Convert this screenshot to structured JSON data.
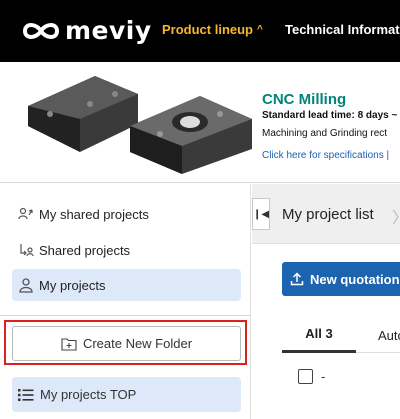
{
  "header": {
    "logo_text": "meviy",
    "nav": {
      "product_lineup": "Product lineup",
      "technical_information": "Technical Informat"
    }
  },
  "banner": {
    "title": "CNC Milling",
    "lead_time": "Standard lead time: 8 days ~",
    "description": "Machining and Grinding rect",
    "link": "Click here for specifications |"
  },
  "sidebar": {
    "items": [
      {
        "label": "My shared projects",
        "icon": "share-out-icon"
      },
      {
        "label": "Shared projects",
        "icon": "share-in-icon"
      },
      {
        "label": "My projects",
        "icon": "user-icon",
        "active": true
      }
    ],
    "create_folder_label": "Create New Folder",
    "projects_top_label": "My projects TOP"
  },
  "main": {
    "title": "My project list",
    "new_quotation_label": "New quotation",
    "tabs": [
      {
        "label": "All 3",
        "active": true
      },
      {
        "label": "Auto"
      }
    ],
    "row_value": "-"
  },
  "colors": {
    "accent_yellow": "#f5b82e",
    "banner_title": "#00857a",
    "primary_button": "#1d64b0",
    "active_item_bg": "#dde8f8",
    "highlight_border": "#d9221c"
  }
}
